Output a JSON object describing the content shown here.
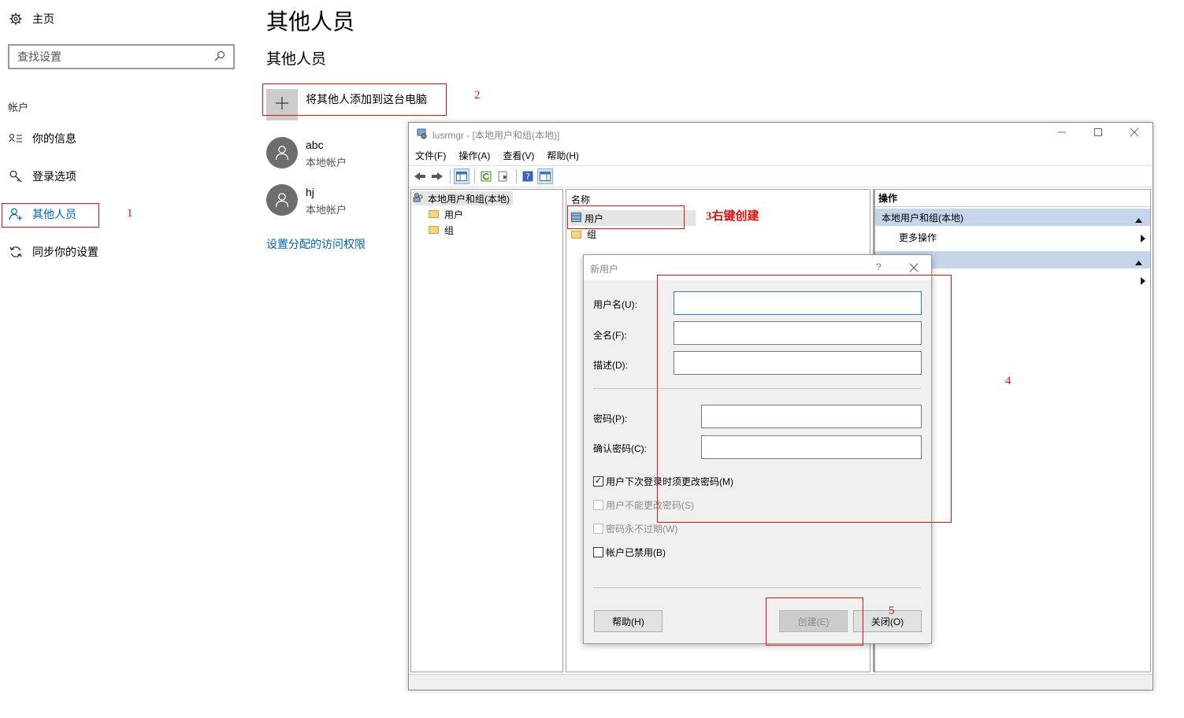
{
  "settings": {
    "home_label": "主页",
    "search_placeholder": "查找设置",
    "section_label": "帐户",
    "nav": {
      "your_info": "你的信息",
      "sign_in": "登录选项",
      "other_people": "其他人员",
      "sync": "同步你的设置"
    },
    "page_title": "其他人员",
    "subtitle": "其他人员",
    "add_button": "将其他人添加到这台电脑",
    "users": [
      {
        "name": "abc",
        "type": "本地帐户"
      },
      {
        "name": "hj",
        "type": "本地帐户"
      }
    ],
    "access_link": "设置分配的访问权限"
  },
  "annotations": {
    "n1": "1",
    "n2": "2",
    "n3": "3右键创建",
    "n4": "4",
    "n5": "5"
  },
  "lusrmgr": {
    "title": "lusrmgr - [本地用户和组(本地)]",
    "menu": {
      "file": "文件(F)",
      "action": "操作(A)",
      "view": "查看(V)",
      "help": "帮助(H)"
    },
    "tree": {
      "root": "本地用户和组(本地)",
      "users": "用户",
      "groups": "组"
    },
    "list": {
      "header": "名称",
      "users": "用户",
      "groups": "组"
    },
    "actions": {
      "header": "操作",
      "section": "本地用户和组(本地)",
      "more": "更多操作"
    }
  },
  "new_user": {
    "title": "新用户",
    "help_glyph": "?",
    "username_label": "用户名(U):",
    "fullname_label": "全名(F):",
    "desc_label": "描述(D):",
    "password_label": "密码(P):",
    "confirm_label": "确认密码(C):",
    "must_change": "用户下次登录时须更改密码(M)",
    "cannot_change": "用户不能更改密码(S)",
    "never_expires": "密码永不过期(W)",
    "disabled": "帐户已禁用(B)",
    "help_btn": "帮助(H)",
    "create_btn": "创建(E)",
    "close_btn": "关闭(O)"
  },
  "colors": {
    "accent": "#0063b1",
    "annotation": "#e01010",
    "action_header": "#c6d6ea"
  }
}
